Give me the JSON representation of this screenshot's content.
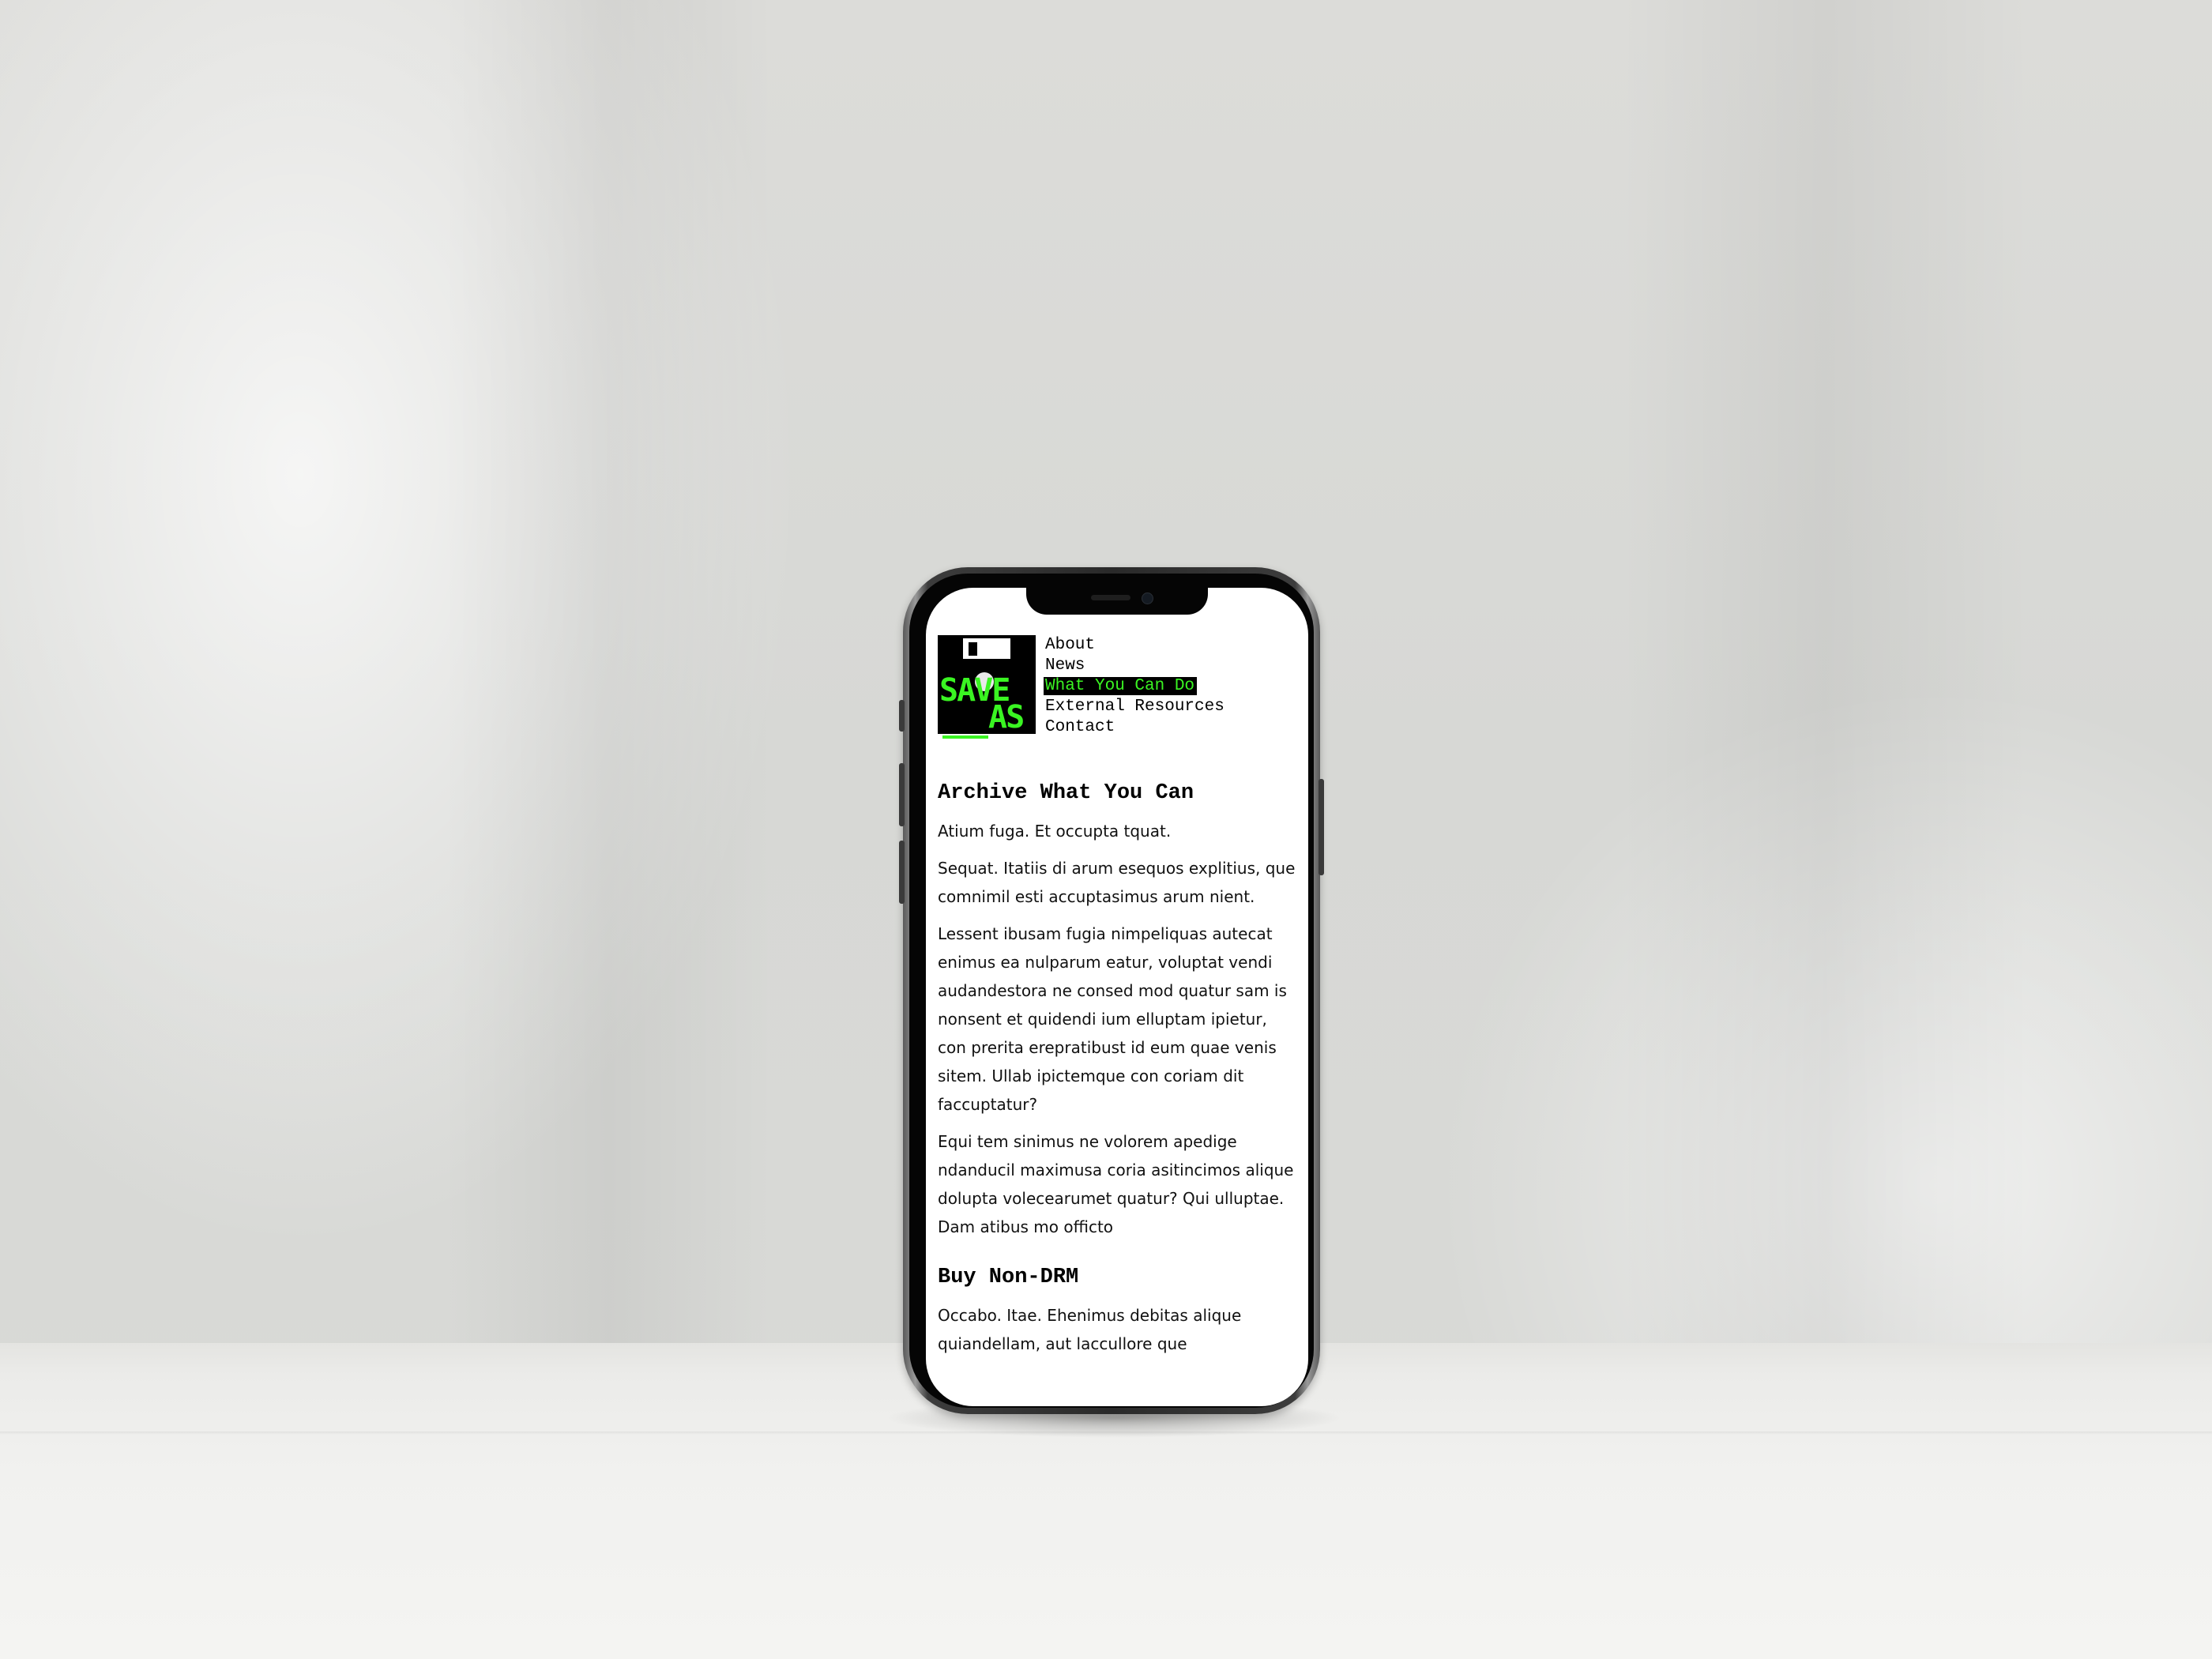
{
  "nav": {
    "items": [
      "About",
      "News",
      "What You Can Do",
      "External Resources",
      "Contact"
    ],
    "active": "What You Can Do"
  },
  "logo": {
    "line1": "SAVE",
    "line2": "AS",
    "icon": "floppy-disk-icon"
  },
  "sections": [
    {
      "heading": "Archive What You Can",
      "paragraphs": [
        "Atium fuga. Et occupta tquat.",
        "Sequat. Itatiis di arum esequos explitius, que comnimil esti accuptasimus arum nient.",
        "Lessent ibusam fugia nimpeliquas autecat enimus ea nulparum eatur, voluptat vendi audandestora ne consed mod quatur sam is nonsent et quidendi ium elluptam ipietur, con prerita erepratibust id eum quae venis sitem. Ullab ipictemque con coriam dit faccuptatur?",
        "Equi tem sinimus ne volorem apedige ndanducil maximusa coria asitincimos alique dolupta volecearumet quatur? Qui ulluptae. Dam atibus mo officto"
      ]
    },
    {
      "heading": "Buy Non-DRM",
      "paragraphs": [
        "Occabo. Itae. Ehenimus debitas alique quiandellam, aut laccullore que"
      ]
    }
  ],
  "colors": {
    "accent_green": "#3af522",
    "logo_black": "#000000",
    "screen_bg": "#ffffff"
  }
}
